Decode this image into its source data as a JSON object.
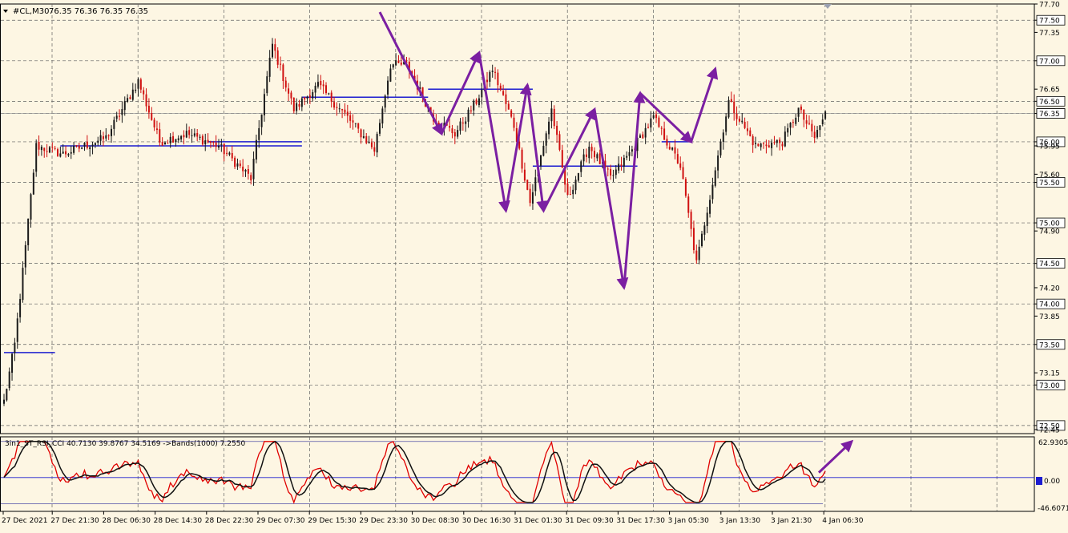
{
  "header": {
    "symbol_label": "#CL,M30",
    "quote_line": "76.35 76.36 76.35 76.35"
  },
  "indicator": {
    "label": "3in1_ST_RSI_CCI 40.7130 39.8767 34.5169 ->Bands(1000) 7.2550",
    "axis_top": "62.9305",
    "axis_zero": "0.00",
    "axis_bottom": "-46.6071"
  },
  "colors": {
    "background": "#fdf6e3",
    "up_candle": "#1a1a1a",
    "down_candle": "#d01010",
    "grid": "#606060",
    "levels": "#1c1cd0",
    "arrows": "#7b1fa2",
    "fast_line": "#e00000",
    "slow_line": "#101010",
    "current_price_line": "#999999"
  },
  "chart_data": {
    "type": "candlestick",
    "symbol": "#CL",
    "timeframe": "M30",
    "ylim": [
      72.4,
      77.7
    ],
    "price_ticks": [
      "77.70",
      "77.50",
      "77.35",
      "77.00",
      "76.65",
      "76.50",
      "76.35",
      "76.00",
      "75.95",
      "75.60",
      "75.50",
      "75.00",
      "74.90",
      "74.50",
      "74.20",
      "74.00",
      "73.85",
      "73.50",
      "73.15",
      "73.00",
      "72.50",
      "72.45"
    ],
    "highlighted_ticks": [
      "77.50",
      "77.00",
      "76.50",
      "76.35",
      "76.00",
      "75.50",
      "75.00",
      "74.50",
      "74.00",
      "73.50",
      "73.00",
      "72.50"
    ],
    "time_labels": [
      "27 Dec 2021",
      "27 Dec 21:30",
      "28 Dec 06:30",
      "28 Dec 14:30",
      "28 Dec 22:30",
      "29 Dec 07:30",
      "29 Dec 15:30",
      "29 Dec 23:30",
      "30 Dec 08:30",
      "30 Dec 16:30",
      "31 Dec 01:30",
      "31 Dec 09:30",
      "31 Dec 17:30",
      "3 Jan 05:30",
      "3 Jan 13:30",
      "3 Jan 21:30",
      "4 Jan 06:30"
    ],
    "current_price": 76.35,
    "keypoints": [
      {
        "i": 0,
        "p": 72.8
      },
      {
        "i": 4,
        "p": 73.5
      },
      {
        "i": 8,
        "p": 74.7
      },
      {
        "i": 12,
        "p": 75.95
      },
      {
        "i": 22,
        "p": 75.85
      },
      {
        "i": 38,
        "p": 76.05
      },
      {
        "i": 50,
        "p": 76.75
      },
      {
        "i": 58,
        "p": 76.0
      },
      {
        "i": 68,
        "p": 76.1
      },
      {
        "i": 80,
        "p": 75.95
      },
      {
        "i": 92,
        "p": 75.55
      },
      {
        "i": 100,
        "p": 77.2
      },
      {
        "i": 108,
        "p": 76.4
      },
      {
        "i": 117,
        "p": 76.7
      },
      {
        "i": 128,
        "p": 76.3
      },
      {
        "i": 138,
        "p": 75.9
      },
      {
        "i": 144,
        "p": 76.95
      },
      {
        "i": 150,
        "p": 76.95
      },
      {
        "i": 160,
        "p": 76.3
      },
      {
        "i": 168,
        "p": 76.1
      },
      {
        "i": 176,
        "p": 76.5
      },
      {
        "i": 182,
        "p": 76.9
      },
      {
        "i": 190,
        "p": 76.2
      },
      {
        "i": 196,
        "p": 75.25
      },
      {
        "i": 204,
        "p": 76.4
      },
      {
        "i": 210,
        "p": 75.3
      },
      {
        "i": 218,
        "p": 75.95
      },
      {
        "i": 226,
        "p": 75.55
      },
      {
        "i": 234,
        "p": 75.9
      },
      {
        "i": 242,
        "p": 76.3
      },
      {
        "i": 252,
        "p": 75.7
      },
      {
        "i": 258,
        "p": 74.5
      },
      {
        "i": 264,
        "p": 75.5
      },
      {
        "i": 270,
        "p": 76.5
      },
      {
        "i": 280,
        "p": 75.95
      },
      {
        "i": 290,
        "p": 76.0
      },
      {
        "i": 296,
        "p": 76.4
      },
      {
        "i": 302,
        "p": 76.05
      },
      {
        "i": 306,
        "p": 76.35
      }
    ],
    "level_lines": [
      {
        "price": 73.4,
        "i0": 0,
        "i1": 19
      },
      {
        "price": 75.95,
        "i0": 21,
        "i1": 111
      },
      {
        "price": 76.0,
        "i0": 76,
        "i1": 111
      },
      {
        "price": 76.55,
        "i0": 111,
        "i1": 158
      },
      {
        "price": 76.65,
        "i0": 158,
        "i1": 197
      },
      {
        "price": 75.7,
        "i0": 197,
        "i1": 236
      },
      {
        "price": 76.0,
        "i0": 245,
        "i1": 256
      }
    ],
    "zigzag_arrows": [
      {
        "from": {
          "i": 140,
          "p": 77.6
        },
        "to": {
          "i": 163,
          "p": 76.1
        }
      },
      {
        "from": {
          "i": 163,
          "p": 76.1
        },
        "to": {
          "i": 177,
          "p": 77.1
        }
      },
      {
        "from": {
          "i": 177,
          "p": 77.1
        },
        "to": {
          "i": 187,
          "p": 75.15
        }
      },
      {
        "from": {
          "i": 187,
          "p": 75.15
        },
        "to": {
          "i": 195,
          "p": 76.7
        }
      },
      {
        "from": {
          "i": 195,
          "p": 76.7
        },
        "to": {
          "i": 201,
          "p": 75.15
        }
      },
      {
        "from": {
          "i": 201,
          "p": 75.15
        },
        "to": {
          "i": 220,
          "p": 76.4
        }
      },
      {
        "from": {
          "i": 220,
          "p": 76.4
        },
        "to": {
          "i": 231,
          "p": 74.2
        }
      },
      {
        "from": {
          "i": 231,
          "p": 74.2
        },
        "to": {
          "i": 237,
          "p": 76.6
        }
      },
      {
        "from": {
          "i": 237,
          "p": 76.6
        },
        "to": {
          "i": 256,
          "p": 76.0
        }
      },
      {
        "from": {
          "i": 256,
          "p": 76.0
        },
        "to": {
          "i": 265,
          "p": 76.9
        }
      }
    ],
    "indicator_ylim": [
      -46.6071,
      62.9305
    ]
  }
}
